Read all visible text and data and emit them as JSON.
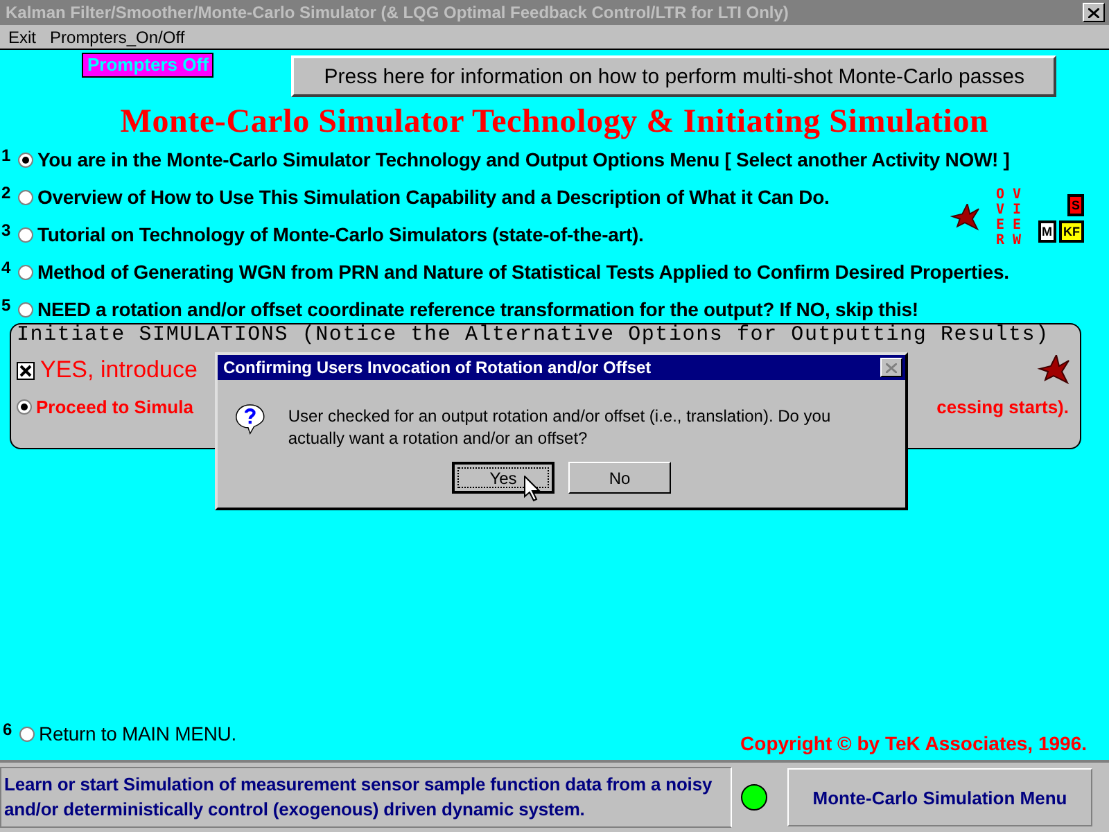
{
  "window": {
    "title": "Kalman Filter/Smoother/Monte-Carlo Simulator (& LQG Optimal Feedback Control/LTR for LTI Only)"
  },
  "menu": [
    "Exit",
    "Prompters_On/Off"
  ],
  "prompters_badge": "Prompters Off",
  "info_button": "Press here for information on how to perform multi-shot Monte-Carlo passes",
  "heading": "Monte-Carlo Simulator Technology & Initiating Simulation",
  "options": [
    {
      "number": "1",
      "label": "You are in the Monte-Carlo Simulator Technology and Output Options Menu [ Select another Activity NOW! ]",
      "selected": true
    },
    {
      "number": "2",
      "label": "Overview of How to Use This Simulation Capability and a Description of What it Can Do.",
      "selected": false
    },
    {
      "number": "3",
      "label": "Tutorial on Technology of Monte-Carlo Simulators (state-of-the-art).",
      "selected": false
    },
    {
      "number": "4",
      "label": "Method of Generating WGN from PRN and Nature of Statistical Tests Applied to Confirm Desired Properties.",
      "selected": false
    },
    {
      "number": "5",
      "label": "NEED a rotation and/or offset coordinate reference transformation for the output? If NO, skip this!",
      "selected": false
    }
  ],
  "overview_logo": {
    "columns": [
      "OVER",
      "VIEW"
    ],
    "blocks": [
      "S",
      "M",
      "KF"
    ]
  },
  "group": {
    "title": "Initiate SIMULATIONS (Notice the Alternative Options for Outputting Results)",
    "checkbox": {
      "label": "YES, introduce",
      "checked": true
    },
    "proceed": {
      "start": "Proceed to Simula",
      "end": "cessing starts).",
      "selected": true
    }
  },
  "return_option": {
    "number": "6",
    "label": "Return to MAIN MENU.",
    "selected": false
  },
  "copyright": "Copyright © by TeK Associates, 1996.",
  "status": {
    "text": "Learn or start Simulation of measurement sensor sample function data from a noisy and/or deterministically control (exogenous) driven dynamic system.",
    "menu_button": "Monte-Carlo Simulation Menu"
  },
  "dialog": {
    "title": "Confirming Users Invocation of Rotation and/or Offset",
    "message": "User checked for an output rotation and/or offset (i.e., translation). Do you actually want a rotation and/or an offset?",
    "buttons": [
      {
        "label": "Yes",
        "selected": true
      },
      {
        "label": "No",
        "selected": false
      }
    ]
  }
}
